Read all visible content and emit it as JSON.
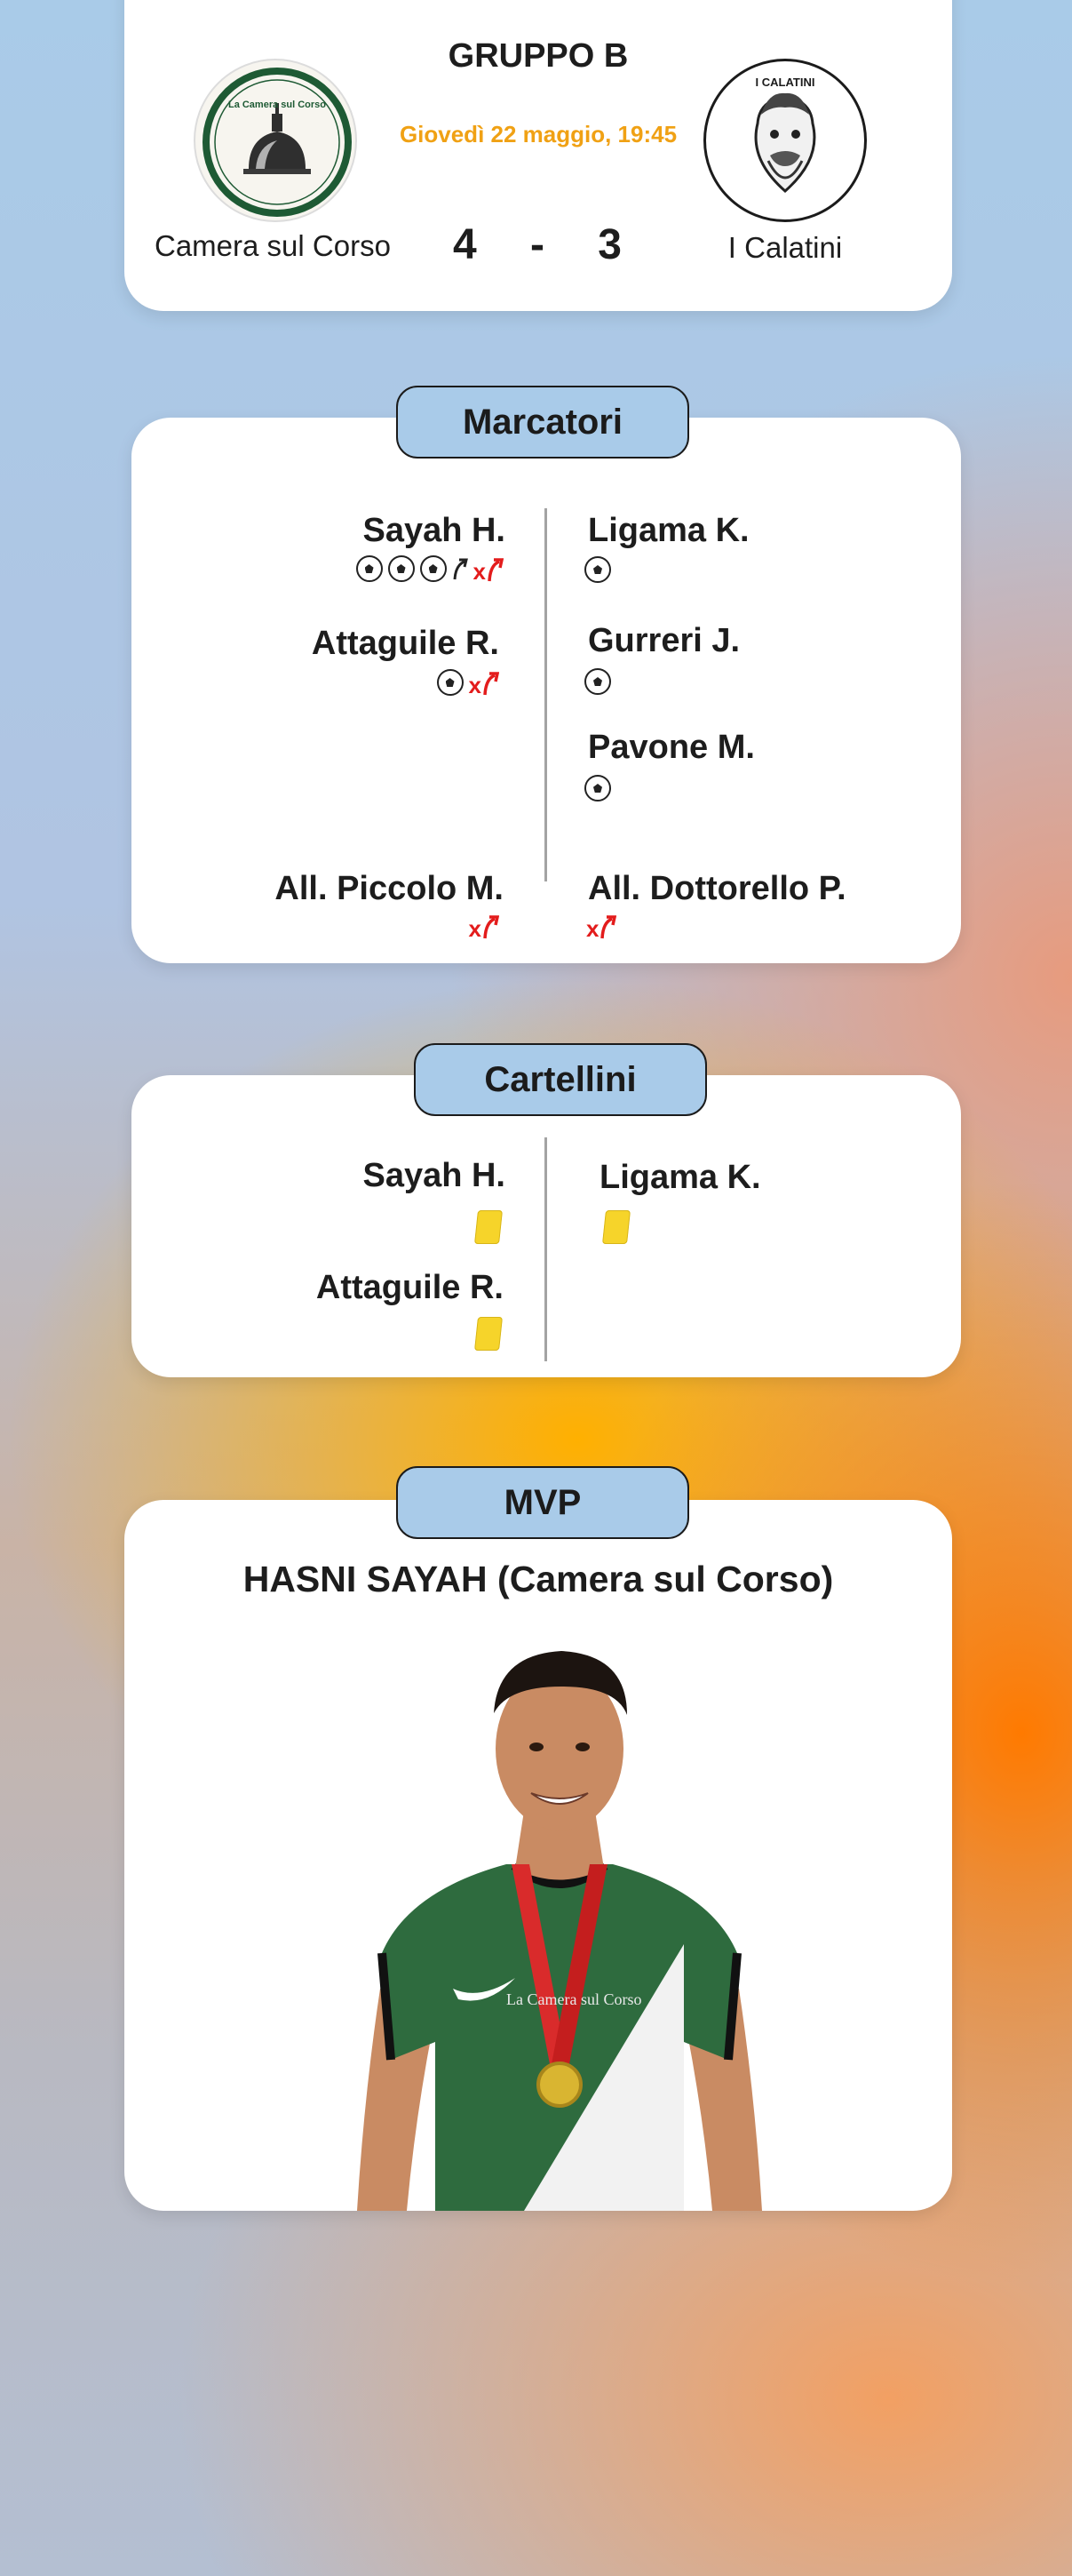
{
  "match": {
    "group": "GRUPPO B",
    "datetime": "Giovedì 22 maggio, 19:45",
    "home": {
      "name": "Camera sul Corso",
      "logo_text": "La Camera sul Corso",
      "score": "4"
    },
    "away": {
      "name": "I Calatini",
      "logo_text": "I CALATINI",
      "score": "3"
    },
    "score_separator": "-"
  },
  "scorers": {
    "title": "Marcatori",
    "home": [
      {
        "name": "Sayah H.",
        "goals": 3,
        "assist": true,
        "subbed": true
      },
      {
        "name": "Attaguile R.",
        "goals": 1,
        "assist": false,
        "subbed": true
      }
    ],
    "away": [
      {
        "name": "Ligama K.",
        "goals": 1
      },
      {
        "name": "Gurreri J.",
        "goals": 1
      },
      {
        "name": "Pavone M.",
        "goals": 1
      }
    ],
    "home_coach": "All. Piccolo M.",
    "away_coach": "All. Dottorello P.",
    "sub_mark": "x"
  },
  "cards": {
    "title": "Cartellini",
    "home": [
      {
        "name": "Sayah H.",
        "card": "yellow"
      },
      {
        "name": "Attaguile R.",
        "card": "yellow"
      }
    ],
    "away": [
      {
        "name": "Ligama K.",
        "card": "yellow"
      }
    ]
  },
  "mvp": {
    "title": "MVP",
    "player": "HASNI SAYAH (Camera sul Corso)",
    "jersey_text": "La Camera sul Corso"
  },
  "colors": {
    "accent_orange": "#f0a114",
    "pill_blue": "#a9cbe9",
    "sub_red": "#e31c1c",
    "yellow_card": "#f6d42a",
    "jersey_green": "#2e6b3e"
  }
}
